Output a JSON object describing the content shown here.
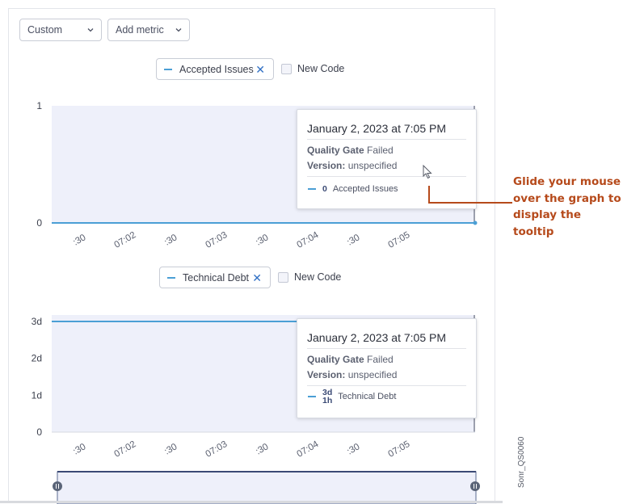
{
  "toolbar": {
    "graph_type": "Custom",
    "add_metric": "Add metric"
  },
  "chart1": {
    "legend": {
      "metric": "Accepted Issues",
      "new_code": "New Code"
    },
    "y_ticks": [
      "1",
      "0"
    ],
    "x_ticks": [
      ":30",
      "07:02",
      ":30",
      "07:03",
      ":30",
      "07:04",
      ":30",
      "07:05"
    ],
    "tooltip": {
      "date": "January 2, 2023 at 7:05 PM",
      "quality_gate_label": "Quality Gate",
      "quality_gate_value": "Failed",
      "version_label": "Version:",
      "version_value": "unspecified",
      "metric_value": "0",
      "metric_name": "Accepted Issues"
    }
  },
  "chart2": {
    "legend": {
      "metric": "Technical Debt",
      "new_code": "New Code"
    },
    "y_ticks": [
      "3d",
      "2d",
      "1d",
      "0"
    ],
    "x_ticks": [
      ":30",
      "07:02",
      ":30",
      "07:03",
      ":30",
      "07:04",
      ":30",
      "07:05"
    ],
    "tooltip": {
      "date": "January 2, 2023 at 7:05 PM",
      "quality_gate_label": "Quality Gate",
      "quality_gate_value": "Failed",
      "version_label": "Version:",
      "version_value": "unspecified",
      "metric_value_line1": "3d",
      "metric_value_line2": "1h",
      "metric_name": "Technical Debt"
    }
  },
  "chart_data": [
    {
      "type": "line",
      "x": [
        ":30",
        "07:02",
        ":30",
        "07:03",
        ":30",
        "07:04",
        ":30",
        "07:05"
      ],
      "series": [
        {
          "name": "Accepted Issues",
          "values": [
            0,
            0,
            0,
            0,
            0,
            0,
            0,
            0
          ]
        }
      ],
      "ylim": [
        0,
        1
      ],
      "grid": false
    },
    {
      "type": "line",
      "x": [
        ":30",
        "07:02",
        ":30",
        "07:03",
        ":30",
        "07:04",
        ":30",
        "07:05"
      ],
      "series": [
        {
          "name": "Technical Debt",
          "values": [
            "3d 1h",
            "3d 1h",
            "3d 1h",
            "3d 1h",
            "3d 1h",
            "3d 1h",
            "3d 1h",
            "3d 1h"
          ]
        }
      ],
      "ylim": [
        "0",
        "3d"
      ],
      "grid": false
    }
  ],
  "annotation": {
    "text": "Glide your mouse over the graph to display the tooltip"
  },
  "watermark": "Sonr_QS0060",
  "colors": {
    "line": "#4b9fd5",
    "plot_bg": "#eef0fa",
    "annotation": "#b64a1b",
    "accent_blue": "#2f6fc4"
  },
  "icons": {
    "dropdown": "chevron-down-icon",
    "remove": "close-icon",
    "cursor": "mouse-pointer-icon",
    "range_handle": "drag-handle-icon"
  }
}
